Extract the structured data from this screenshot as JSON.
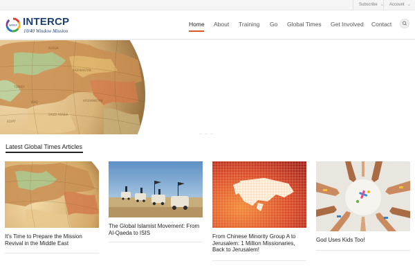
{
  "topbar": {
    "subscribe_label": "Subscribe",
    "account_label": "Account"
  },
  "logo": {
    "name": "INTERCP",
    "tagline": "10/40 Window Mission",
    "mark_text": "INTERCP"
  },
  "nav": {
    "items": [
      {
        "label": "Home"
      },
      {
        "label": "About"
      },
      {
        "label": "Training"
      },
      {
        "label": "Go"
      },
      {
        "label": "Global Times"
      },
      {
        "label": "Get Involved"
      },
      {
        "label": "Contact"
      }
    ],
    "active": "Home"
  },
  "hero": {
    "image": "globe-europe-middle-east"
  },
  "section": {
    "title": "Latest Global Times Articles"
  },
  "articles": [
    {
      "title": "It's Time to Prepare the Mission Revival in the Middle East",
      "image": "globe-middle-east"
    },
    {
      "title": "The Global Islamist Movement: From Al-Qaeda to ISIS",
      "image": "convoy-desert"
    },
    {
      "title": "From Chinese Minority Group A to Jerusalem: 1 Million Missionaries, Back to Jerusalem!",
      "image": "pixel-world-map"
    },
    {
      "title": "God Uses Kids Too!",
      "image": "kids-hands-circle"
    }
  ],
  "colors": {
    "brand": "#1b3f73",
    "accent": "#e0522f"
  }
}
